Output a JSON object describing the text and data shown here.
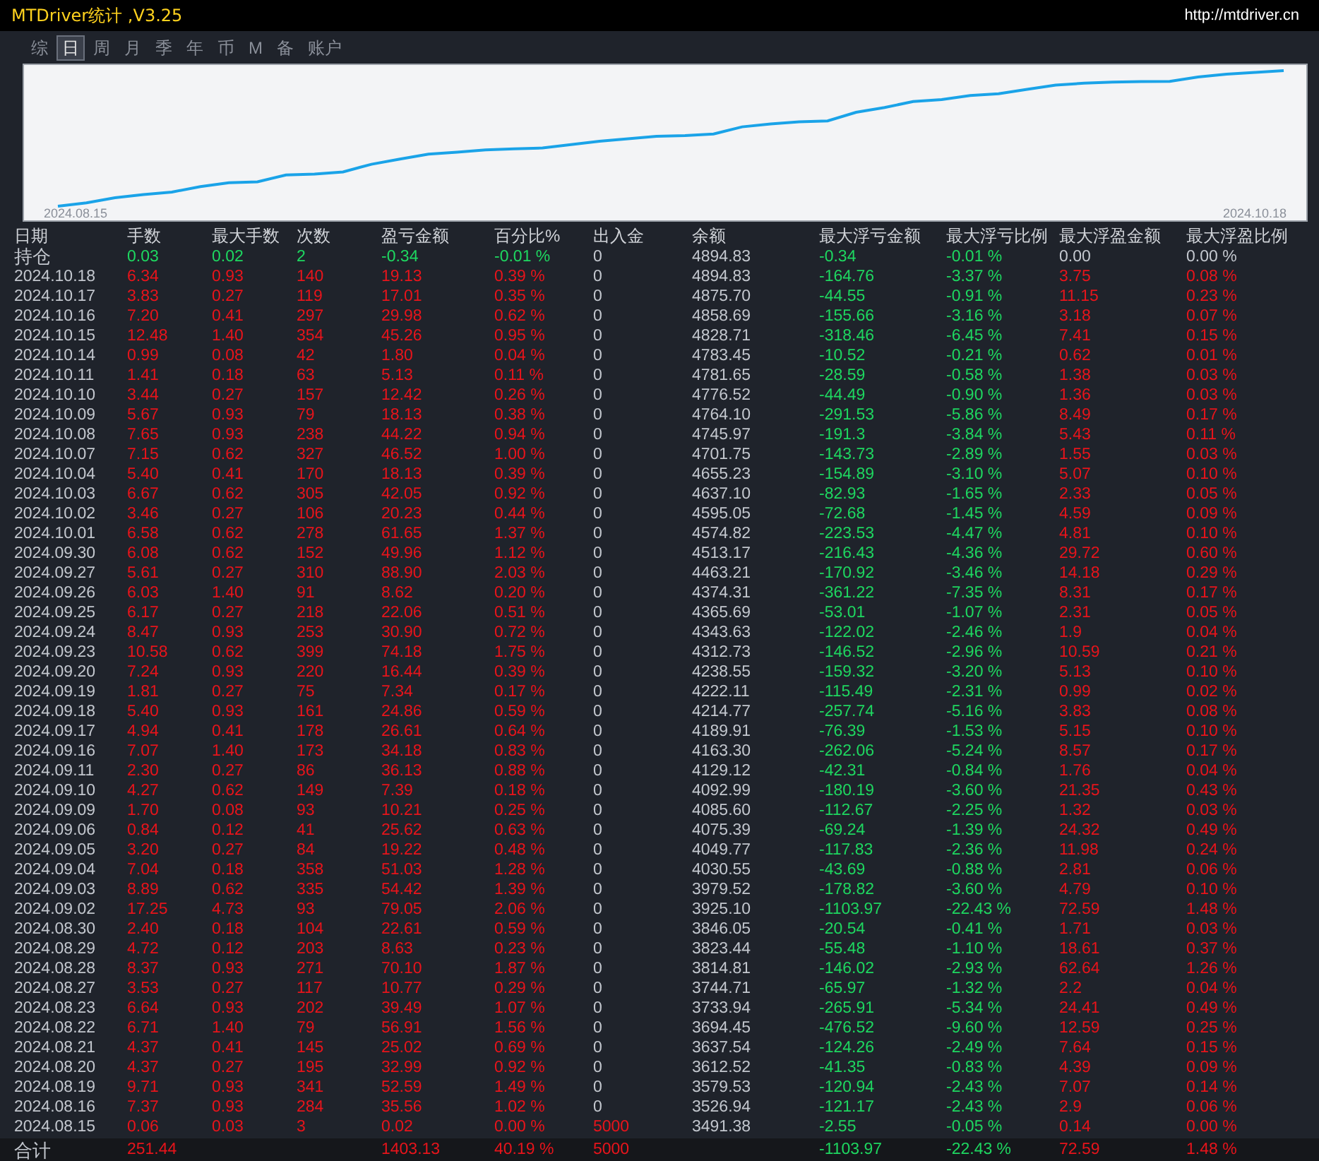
{
  "window": {
    "title": "MTDriver统计 ,V3.25",
    "url": "http://mtdriver.cn"
  },
  "tabs": [
    {
      "label": "综",
      "selected": false
    },
    {
      "label": "日",
      "selected": true
    },
    {
      "label": "周",
      "selected": false
    },
    {
      "label": "月",
      "selected": false
    },
    {
      "label": "季",
      "selected": false
    },
    {
      "label": "年",
      "selected": false
    },
    {
      "label": "币",
      "selected": false
    },
    {
      "label": "M",
      "selected": false
    },
    {
      "label": "备",
      "selected": false
    },
    {
      "label": "账户",
      "selected": false
    }
  ],
  "chart": {
    "start_label": "2024.08.15",
    "end_label": "2024.10.18"
  },
  "table": {
    "columns": [
      "日期",
      "手数",
      "最大手数",
      "次数",
      "盈亏金额",
      "百分比%",
      "出入金",
      "余额",
      "最大浮亏金额",
      "最大浮亏比例",
      "最大浮盈金额",
      "最大浮盈比例"
    ],
    "rows": [
      {
        "kind": "position",
        "cells": [
          "持仓",
          "0.03",
          "0.02",
          "2",
          "-0.34",
          "-0.01 %",
          "0",
          "4894.83",
          "-0.34",
          "-0.01 %",
          "0.00",
          "0.00 %"
        ]
      },
      {
        "kind": "day",
        "cells": [
          "2024.10.18",
          "6.34",
          "0.93",
          "140",
          "19.13",
          "0.39 %",
          "0",
          "4894.83",
          "-164.76",
          "-3.37 %",
          "3.75",
          "0.08 %"
        ]
      },
      {
        "kind": "day",
        "cells": [
          "2024.10.17",
          "3.83",
          "0.27",
          "119",
          "17.01",
          "0.35 %",
          "0",
          "4875.70",
          "-44.55",
          "-0.91 %",
          "11.15",
          "0.23 %"
        ]
      },
      {
        "kind": "day",
        "cells": [
          "2024.10.16",
          "7.20",
          "0.41",
          "297",
          "29.98",
          "0.62 %",
          "0",
          "4858.69",
          "-155.66",
          "-3.16 %",
          "3.18",
          "0.07 %"
        ]
      },
      {
        "kind": "day",
        "cells": [
          "2024.10.15",
          "12.48",
          "1.40",
          "354",
          "45.26",
          "0.95 %",
          "0",
          "4828.71",
          "-318.46",
          "-6.45 %",
          "7.41",
          "0.15 %"
        ]
      },
      {
        "kind": "day",
        "cells": [
          "2024.10.14",
          "0.99",
          "0.08",
          "42",
          "1.80",
          "0.04 %",
          "0",
          "4783.45",
          "-10.52",
          "-0.21 %",
          "0.62",
          "0.01 %"
        ]
      },
      {
        "kind": "day",
        "cells": [
          "2024.10.11",
          "1.41",
          "0.18",
          "63",
          "5.13",
          "0.11 %",
          "0",
          "4781.65",
          "-28.59",
          "-0.58 %",
          "1.38",
          "0.03 %"
        ]
      },
      {
        "kind": "day",
        "cells": [
          "2024.10.10",
          "3.44",
          "0.27",
          "157",
          "12.42",
          "0.26 %",
          "0",
          "4776.52",
          "-44.49",
          "-0.90 %",
          "1.36",
          "0.03 %"
        ]
      },
      {
        "kind": "day",
        "cells": [
          "2024.10.09",
          "5.67",
          "0.93",
          "79",
          "18.13",
          "0.38 %",
          "0",
          "4764.10",
          "-291.53",
          "-5.86 %",
          "8.49",
          "0.17 %"
        ]
      },
      {
        "kind": "day",
        "cells": [
          "2024.10.08",
          "7.65",
          "0.93",
          "238",
          "44.22",
          "0.94 %",
          "0",
          "4745.97",
          "-191.3",
          "-3.84 %",
          "5.43",
          "0.11 %"
        ]
      },
      {
        "kind": "day",
        "cells": [
          "2024.10.07",
          "7.15",
          "0.62",
          "327",
          "46.52",
          "1.00 %",
          "0",
          "4701.75",
          "-143.73",
          "-2.89 %",
          "1.55",
          "0.03 %"
        ]
      },
      {
        "kind": "day",
        "cells": [
          "2024.10.04",
          "5.40",
          "0.41",
          "170",
          "18.13",
          "0.39 %",
          "0",
          "4655.23",
          "-154.89",
          "-3.10 %",
          "5.07",
          "0.10 %"
        ]
      },
      {
        "kind": "day",
        "cells": [
          "2024.10.03",
          "6.67",
          "0.62",
          "305",
          "42.05",
          "0.92 %",
          "0",
          "4637.10",
          "-82.93",
          "-1.65 %",
          "2.33",
          "0.05 %"
        ]
      },
      {
        "kind": "day",
        "cells": [
          "2024.10.02",
          "3.46",
          "0.27",
          "106",
          "20.23",
          "0.44 %",
          "0",
          "4595.05",
          "-72.68",
          "-1.45 %",
          "4.59",
          "0.09 %"
        ]
      },
      {
        "kind": "day",
        "cells": [
          "2024.10.01",
          "6.58",
          "0.62",
          "278",
          "61.65",
          "1.37 %",
          "0",
          "4574.82",
          "-223.53",
          "-4.47 %",
          "4.81",
          "0.10 %"
        ]
      },
      {
        "kind": "day",
        "cells": [
          "2024.09.30",
          "6.08",
          "0.62",
          "152",
          "49.96",
          "1.12 %",
          "0",
          "4513.17",
          "-216.43",
          "-4.36 %",
          "29.72",
          "0.60 %"
        ]
      },
      {
        "kind": "day",
        "cells": [
          "2024.09.27",
          "5.61",
          "0.27",
          "310",
          "88.90",
          "2.03 %",
          "0",
          "4463.21",
          "-170.92",
          "-3.46 %",
          "14.18",
          "0.29 %"
        ]
      },
      {
        "kind": "day",
        "cells": [
          "2024.09.26",
          "6.03",
          "1.40",
          "91",
          "8.62",
          "0.20 %",
          "0",
          "4374.31",
          "-361.22",
          "-7.35 %",
          "8.31",
          "0.17 %"
        ]
      },
      {
        "kind": "day",
        "cells": [
          "2024.09.25",
          "6.17",
          "0.27",
          "218",
          "22.06",
          "0.51 %",
          "0",
          "4365.69",
          "-53.01",
          "-1.07 %",
          "2.31",
          "0.05 %"
        ]
      },
      {
        "kind": "day",
        "cells": [
          "2024.09.24",
          "8.47",
          "0.93",
          "253",
          "30.90",
          "0.72 %",
          "0",
          "4343.63",
          "-122.02",
          "-2.46 %",
          "1.9",
          "0.04 %"
        ]
      },
      {
        "kind": "day",
        "cells": [
          "2024.09.23",
          "10.58",
          "0.62",
          "399",
          "74.18",
          "1.75 %",
          "0",
          "4312.73",
          "-146.52",
          "-2.96 %",
          "10.59",
          "0.21 %"
        ]
      },
      {
        "kind": "day",
        "cells": [
          "2024.09.20",
          "7.24",
          "0.93",
          "220",
          "16.44",
          "0.39 %",
          "0",
          "4238.55",
          "-159.32",
          "-3.20 %",
          "5.13",
          "0.10 %"
        ]
      },
      {
        "kind": "day",
        "cells": [
          "2024.09.19",
          "1.81",
          "0.27",
          "75",
          "7.34",
          "0.17 %",
          "0",
          "4222.11",
          "-115.49",
          "-2.31 %",
          "0.99",
          "0.02 %"
        ]
      },
      {
        "kind": "day",
        "cells": [
          "2024.09.18",
          "5.40",
          "0.93",
          "161",
          "24.86",
          "0.59 %",
          "0",
          "4214.77",
          "-257.74",
          "-5.16 %",
          "3.83",
          "0.08 %"
        ]
      },
      {
        "kind": "day",
        "cells": [
          "2024.09.17",
          "4.94",
          "0.41",
          "178",
          "26.61",
          "0.64 %",
          "0",
          "4189.91",
          "-76.39",
          "-1.53 %",
          "5.15",
          "0.10 %"
        ]
      },
      {
        "kind": "day",
        "cells": [
          "2024.09.16",
          "7.07",
          "1.40",
          "173",
          "34.18",
          "0.83 %",
          "0",
          "4163.30",
          "-262.06",
          "-5.24 %",
          "8.57",
          "0.17 %"
        ]
      },
      {
        "kind": "day",
        "cells": [
          "2024.09.11",
          "2.30",
          "0.27",
          "86",
          "36.13",
          "0.88 %",
          "0",
          "4129.12",
          "-42.31",
          "-0.84 %",
          "1.76",
          "0.04 %"
        ]
      },
      {
        "kind": "day",
        "cells": [
          "2024.09.10",
          "4.27",
          "0.62",
          "149",
          "7.39",
          "0.18 %",
          "0",
          "4092.99",
          "-180.19",
          "-3.60 %",
          "21.35",
          "0.43 %"
        ]
      },
      {
        "kind": "day",
        "cells": [
          "2024.09.09",
          "1.70",
          "0.08",
          "93",
          "10.21",
          "0.25 %",
          "0",
          "4085.60",
          "-112.67",
          "-2.25 %",
          "1.32",
          "0.03 %"
        ]
      },
      {
        "kind": "day",
        "cells": [
          "2024.09.06",
          "0.84",
          "0.12",
          "41",
          "25.62",
          "0.63 %",
          "0",
          "4075.39",
          "-69.24",
          "-1.39 %",
          "24.32",
          "0.49 %"
        ]
      },
      {
        "kind": "day",
        "cells": [
          "2024.09.05",
          "3.20",
          "0.27",
          "84",
          "19.22",
          "0.48 %",
          "0",
          "4049.77",
          "-117.83",
          "-2.36 %",
          "11.98",
          "0.24 %"
        ]
      },
      {
        "kind": "day",
        "cells": [
          "2024.09.04",
          "7.04",
          "0.18",
          "358",
          "51.03",
          "1.28 %",
          "0",
          "4030.55",
          "-43.69",
          "-0.88 %",
          "2.81",
          "0.06 %"
        ]
      },
      {
        "kind": "day",
        "cells": [
          "2024.09.03",
          "8.89",
          "0.62",
          "335",
          "54.42",
          "1.39 %",
          "0",
          "3979.52",
          "-178.82",
          "-3.60 %",
          "4.79",
          "0.10 %"
        ]
      },
      {
        "kind": "day",
        "cells": [
          "2024.09.02",
          "17.25",
          "4.73",
          "93",
          "79.05",
          "2.06 %",
          "0",
          "3925.10",
          "-1103.97",
          "-22.43 %",
          "72.59",
          "1.48 %"
        ]
      },
      {
        "kind": "day",
        "cells": [
          "2024.08.30",
          "2.40",
          "0.18",
          "104",
          "22.61",
          "0.59 %",
          "0",
          "3846.05",
          "-20.54",
          "-0.41 %",
          "1.71",
          "0.03 %"
        ]
      },
      {
        "kind": "day",
        "cells": [
          "2024.08.29",
          "4.72",
          "0.12",
          "203",
          "8.63",
          "0.23 %",
          "0",
          "3823.44",
          "-55.48",
          "-1.10 %",
          "18.61",
          "0.37 %"
        ]
      },
      {
        "kind": "day",
        "cells": [
          "2024.08.28",
          "8.37",
          "0.93",
          "271",
          "70.10",
          "1.87 %",
          "0",
          "3814.81",
          "-146.02",
          "-2.93 %",
          "62.64",
          "1.26 %"
        ]
      },
      {
        "kind": "day",
        "cells": [
          "2024.08.27",
          "3.53",
          "0.27",
          "117",
          "10.77",
          "0.29 %",
          "0",
          "3744.71",
          "-65.97",
          "-1.32 %",
          "2.2",
          "0.04 %"
        ]
      },
      {
        "kind": "day",
        "cells": [
          "2024.08.23",
          "6.64",
          "0.93",
          "202",
          "39.49",
          "1.07 %",
          "0",
          "3733.94",
          "-265.91",
          "-5.34 %",
          "24.41",
          "0.49 %"
        ]
      },
      {
        "kind": "day",
        "cells": [
          "2024.08.22",
          "6.71",
          "1.40",
          "79",
          "56.91",
          "1.56 %",
          "0",
          "3694.45",
          "-476.52",
          "-9.60 %",
          "12.59",
          "0.25 %"
        ]
      },
      {
        "kind": "day",
        "cells": [
          "2024.08.21",
          "4.37",
          "0.41",
          "145",
          "25.02",
          "0.69 %",
          "0",
          "3637.54",
          "-124.26",
          "-2.49 %",
          "7.64",
          "0.15 %"
        ]
      },
      {
        "kind": "day",
        "cells": [
          "2024.08.20",
          "4.37",
          "0.27",
          "195",
          "32.99",
          "0.92 %",
          "0",
          "3612.52",
          "-41.35",
          "-0.83 %",
          "4.39",
          "0.09 %"
        ]
      },
      {
        "kind": "day",
        "cells": [
          "2024.08.19",
          "9.71",
          "0.93",
          "341",
          "52.59",
          "1.49 %",
          "0",
          "3579.53",
          "-120.94",
          "-2.43 %",
          "7.07",
          "0.14 %"
        ]
      },
      {
        "kind": "day",
        "cells": [
          "2024.08.16",
          "7.37",
          "0.93",
          "284",
          "35.56",
          "1.02 %",
          "0",
          "3526.94",
          "-121.17",
          "-2.43 %",
          "2.9",
          "0.06 %"
        ]
      },
      {
        "kind": "deposit",
        "cells": [
          "2024.08.15",
          "0.06",
          "0.03",
          "3",
          "0.02",
          "0.00 %",
          "5000",
          "3491.38",
          "-2.55",
          "-0.05 %",
          "0.14",
          "0.00 %"
        ]
      },
      {
        "kind": "total",
        "cells": [
          "合计",
          "251.44",
          null,
          null,
          "1403.13",
          "40.19 %",
          "5000",
          null,
          "-1103.97",
          "-22.43 %",
          "72.59",
          "1.48 %"
        ]
      }
    ]
  }
}
